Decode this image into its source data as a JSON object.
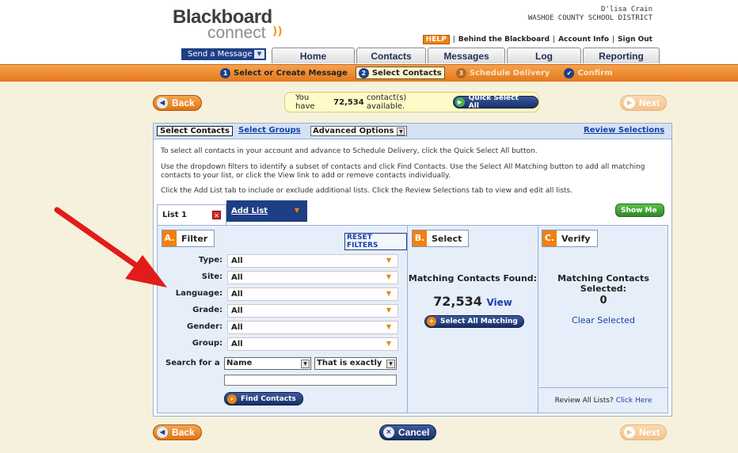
{
  "header": {
    "logo_word1": "Blackboard",
    "logo_word2": "connect",
    "user_name": "D'lisa Crain",
    "district": "WASHOE COUNTY SCHOOL DISTRICT",
    "help_label": "HELP",
    "links": [
      "Behind the Blackboard",
      "Account Info",
      "Sign Out"
    ]
  },
  "nav": {
    "send_message": "Send a Message",
    "tabs": [
      "Home",
      "Contacts",
      "Messages",
      "Log",
      "Reporting"
    ]
  },
  "steps": [
    {
      "num": "1",
      "label": "Select or Create Message"
    },
    {
      "num": "2",
      "label": "Select Contacts"
    },
    {
      "num": "3",
      "label": "Schedule Delivery"
    },
    {
      "num": "✔",
      "label": "Confirm"
    }
  ],
  "buttons": {
    "back": "Back",
    "next": "Next",
    "cancel": "Cancel",
    "quick_select_all": "Quick Select All"
  },
  "availability": {
    "prefix": "You have",
    "count": "72,534",
    "suffix": "contact(s) available."
  },
  "panel_tabs": {
    "select_contacts": "Select Contacts",
    "select_groups": "Select Groups",
    "advanced_options": "Advanced Options",
    "review_selections": "Review Selections"
  },
  "instructions": [
    "To select all contacts in your account and advance to Schedule Delivery, click the Quick Select All button.",
    "Use the dropdown filters to identify a subset of contacts and click Find Contacts. Use the Select All Matching button to add all matching contacts to your list, or click the View link to add or remove contacts individually.",
    "Click the Add List tab to include or exclude additional lists. Click the Review Selections tab to view and edit all lists."
  ],
  "list_tabs": {
    "list1": "List 1",
    "add_list": "Add List",
    "show_me": "Show Me"
  },
  "filter": {
    "letter": "A.",
    "title": "Filter",
    "reset": "RESET FILTERS",
    "rows": [
      {
        "label": "Type:",
        "value": "All"
      },
      {
        "label": "Site:",
        "value": "All"
      },
      {
        "label": "Language:",
        "value": "All"
      },
      {
        "label": "Grade:",
        "value": "All"
      },
      {
        "label": "Gender:",
        "value": "All"
      },
      {
        "label": "Group:",
        "value": "All"
      }
    ],
    "search_label": "Search for a",
    "search_field": "Name",
    "search_op": "That is exactly",
    "search_value": "",
    "find_button": "Find Contacts"
  },
  "select_col": {
    "letter": "B.",
    "title": "Select",
    "found_label": "Matching Contacts Found:",
    "found_count": "72,534",
    "view_link": "View",
    "select_all_matching": "Select All Matching"
  },
  "verify_col": {
    "letter": "C.",
    "title": "Verify",
    "selected_label": "Matching Contacts Selected:",
    "selected_count": "0",
    "clear_link": "Clear Selected",
    "review_prefix": "Review All Lists?",
    "review_link": "Click Here"
  },
  "colors": {
    "orange": "#f0810f",
    "navy": "#1d3f86",
    "annotation_arrow": "#e21b1b"
  }
}
